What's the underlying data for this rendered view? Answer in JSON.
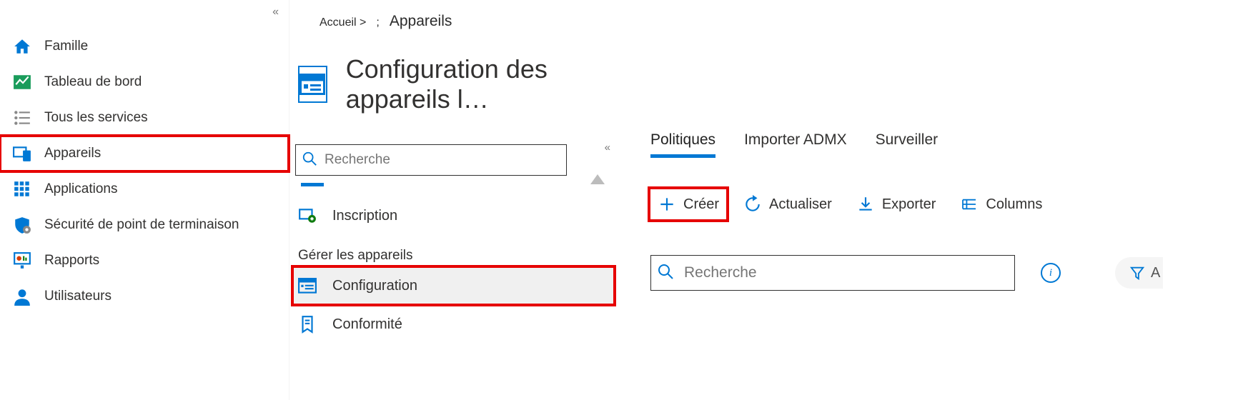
{
  "sidebar": {
    "items": [
      {
        "id": "famille",
        "label": "Famille"
      },
      {
        "id": "dashboard",
        "label": "Tableau de bord"
      },
      {
        "id": "services",
        "label": "Tous les services"
      },
      {
        "id": "appareils",
        "label": "Appareils"
      },
      {
        "id": "apps",
        "label": "Applications"
      },
      {
        "id": "security",
        "label": "Sécurité de point de terminaison"
      },
      {
        "id": "rapports",
        "label": "Rapports"
      },
      {
        "id": "users",
        "label": "Utilisateurs"
      }
    ]
  },
  "breadcrumb": {
    "home": "Accueil >",
    "sep": ";",
    "current": "Appareils"
  },
  "page_title": "Configuration des appareils l…",
  "search_placeholder": "Recherche",
  "middle": {
    "inscription": "Inscription",
    "section": "Gérer les appareils",
    "configuration": "Configuration",
    "conformite": "Conformité"
  },
  "tabs": {
    "politiques": "Politiques",
    "importer_admx": "Importer ADMX",
    "surveiller": "Surveiller"
  },
  "commands": {
    "creer": "Créer",
    "actualiser": "Actualiser",
    "exporter": "Exporter",
    "columns": "Columns"
  },
  "right_search_placeholder": "Recherche",
  "filter_label": "A"
}
